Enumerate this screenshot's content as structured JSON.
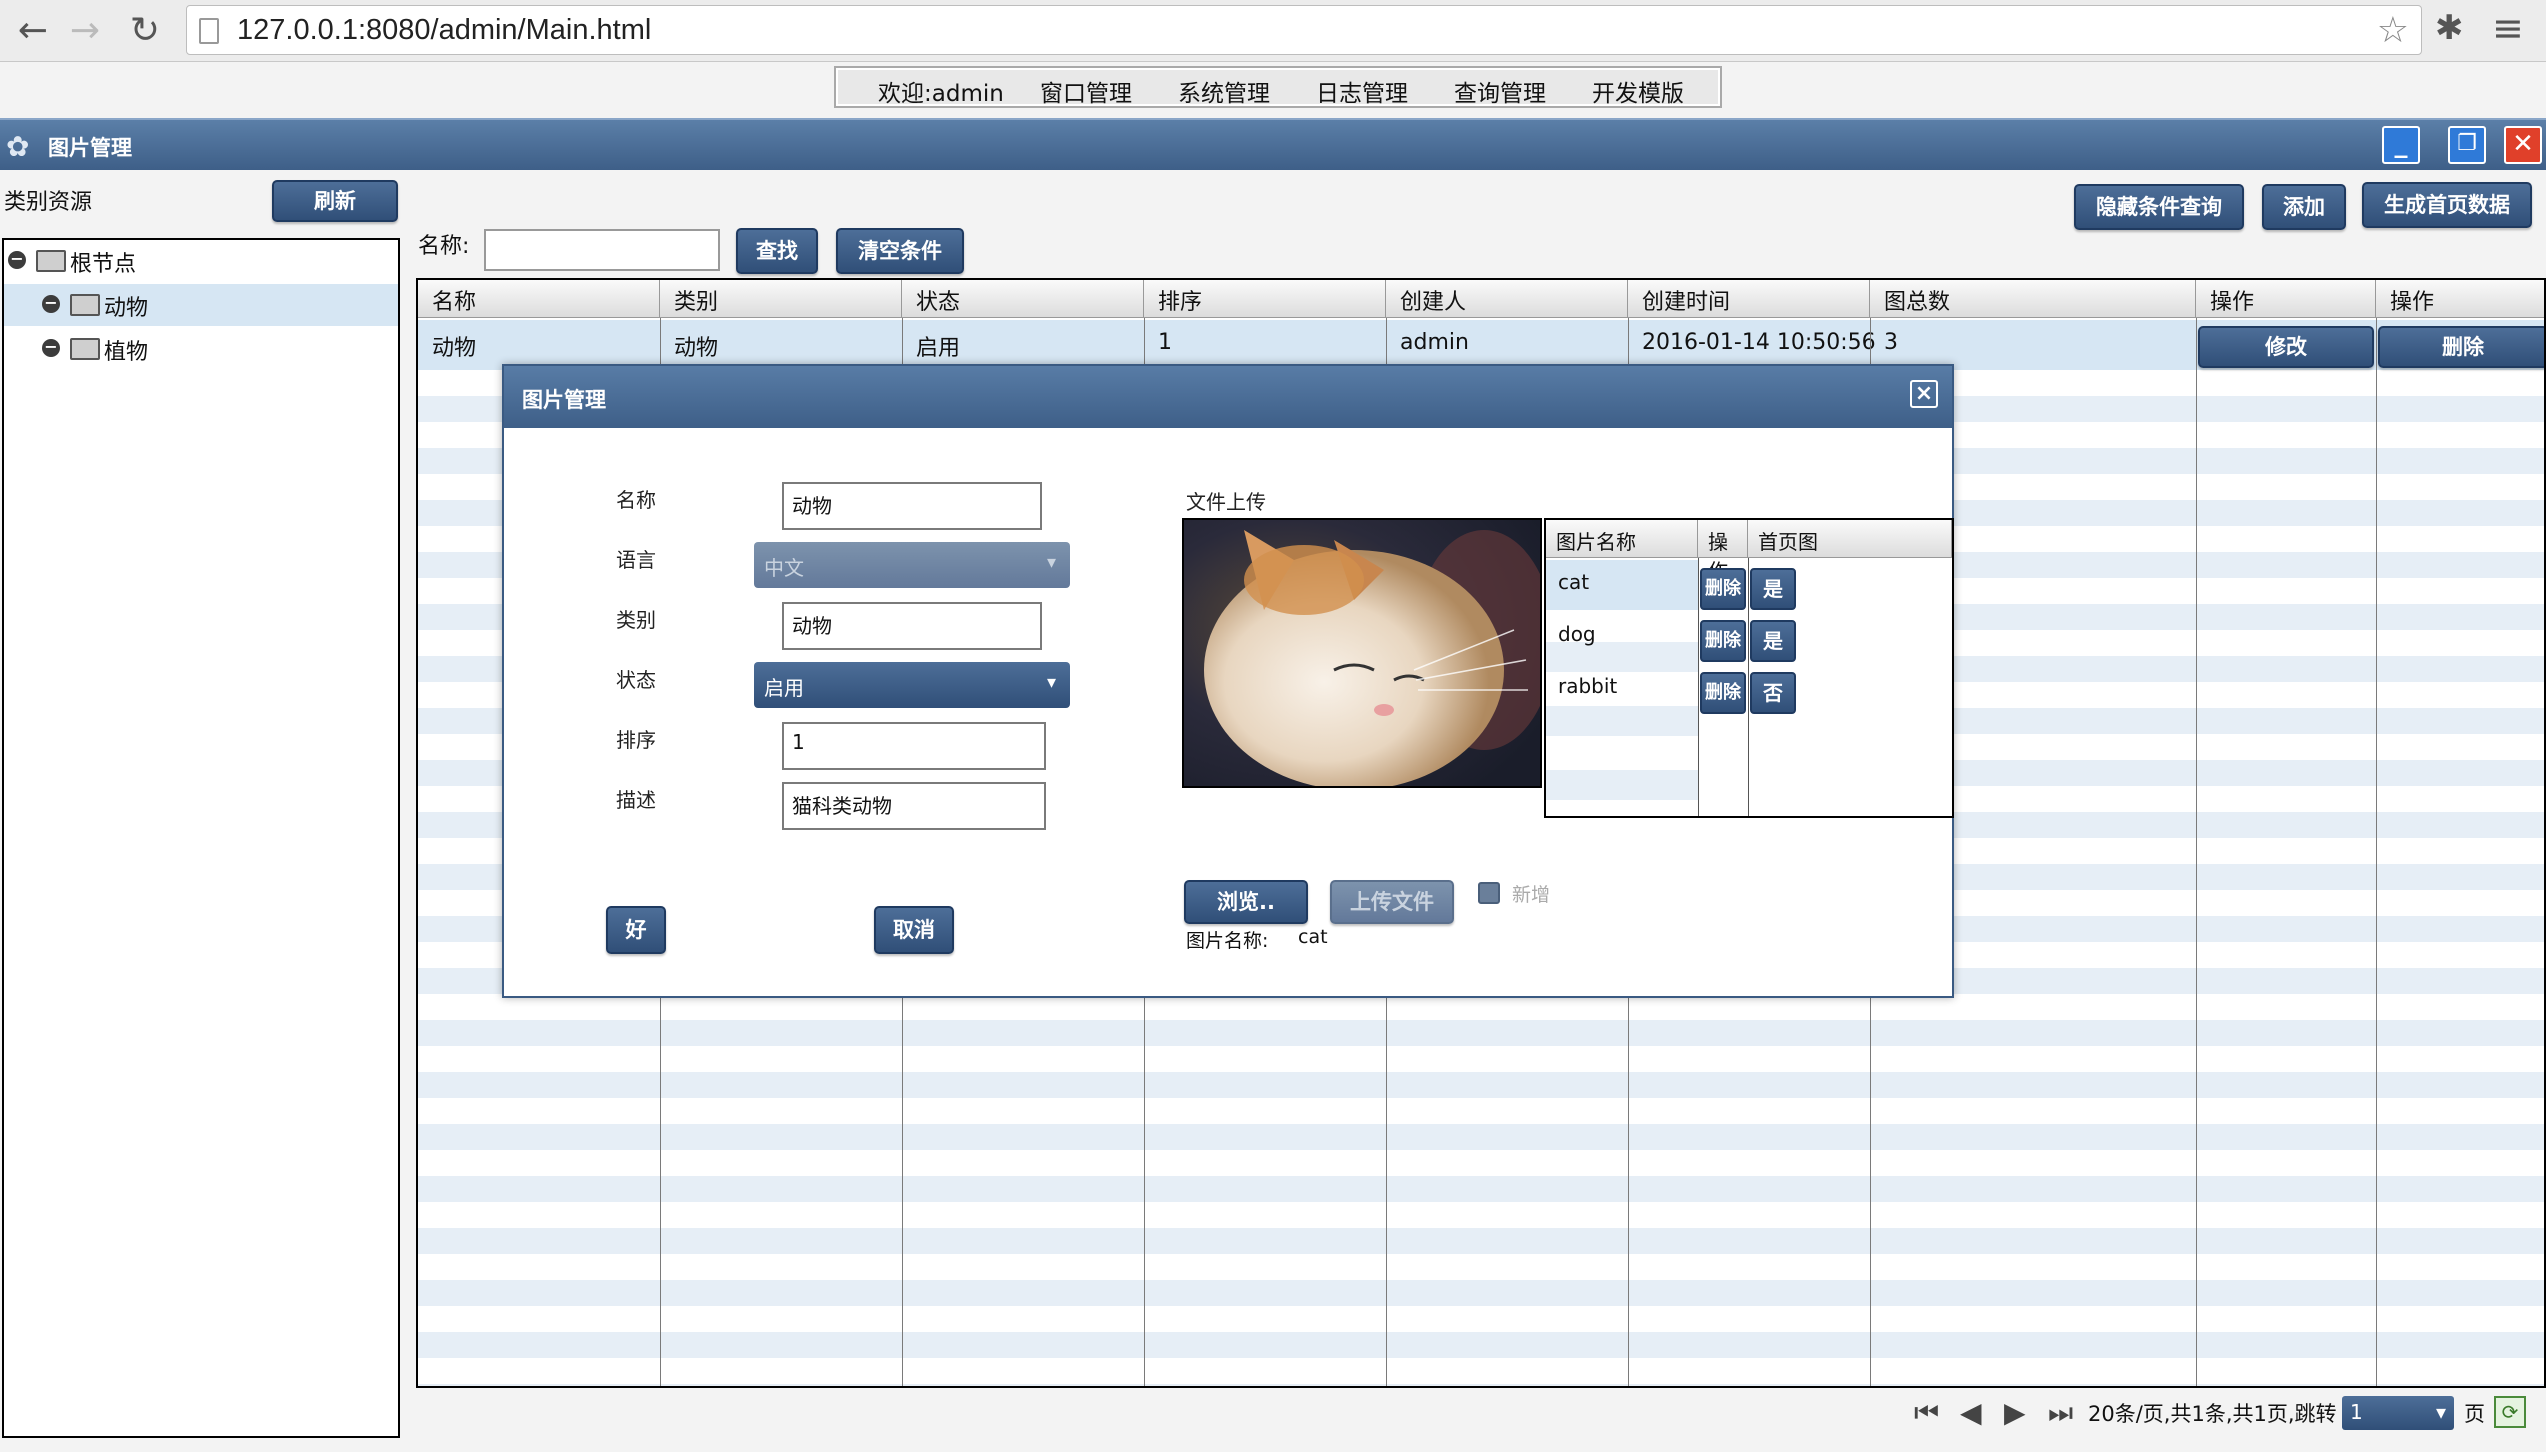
{
  "browser": {
    "url": "127.0.0.1:8080/admin/Main.html",
    "back_glyph": "←",
    "forward_glyph": "→",
    "reload_glyph": "↻"
  },
  "top_menu": {
    "welcome": "欢迎:admin",
    "items": [
      "窗口管理",
      "系统管理",
      "日志管理",
      "查询管理",
      "开发模版"
    ]
  },
  "window": {
    "title": "图片管理"
  },
  "left_panel": {
    "label": "类别资源",
    "refresh_button": "刷新",
    "tree": {
      "root": "根节点",
      "children": [
        "动物",
        "植物"
      ],
      "selected": "动物"
    }
  },
  "search": {
    "name_label": "名称:",
    "name_value": "",
    "search_button": "查找",
    "clear_button": "清空条件"
  },
  "toolbar": {
    "hide_query_button": "隐藏条件查询",
    "add_button": "添加",
    "generate_button": "生成首页数据"
  },
  "grid": {
    "columns": [
      "名称",
      "类别",
      "状态",
      "排序",
      "创建人",
      "创建时间",
      "图总数",
      "操作",
      "操作"
    ],
    "rows": [
      {
        "name": "动物",
        "category": "动物",
        "status": "启用",
        "order": "1",
        "creator": "admin",
        "created": "2016-01-14 10:50:56",
        "count": "3",
        "edit": "修改",
        "delete": "删除"
      }
    ]
  },
  "pager": {
    "summary": "20条/页,共1条,共1页,跳转",
    "page_value": "1",
    "page_suffix": "页"
  },
  "dialog": {
    "title": "图片管理",
    "close_glyph": "×",
    "form": {
      "name_label": "名称",
      "name_value": "动物",
      "language_label": "语言",
      "language_value": "中文",
      "category_label": "类别",
      "category_value": "动物",
      "status_label": "状态",
      "status_value": "启用",
      "order_label": "排序",
      "order_value": "1",
      "description_label": "描述",
      "description_value": "猫科类动物",
      "ok_button": "好",
      "cancel_button": "取消"
    },
    "upload": {
      "label": "文件上传",
      "browse_button": "浏览..",
      "upload_button": "上传文件",
      "new_label": "新增",
      "image_name_label": "图片名称:",
      "image_name_value": "cat",
      "columns": [
        "图片名称",
        "操作",
        "首页图"
      ],
      "images": [
        {
          "name": "cat",
          "action": "删除",
          "home": "是"
        },
        {
          "name": "dog",
          "action": "删除",
          "home": "是"
        },
        {
          "name": "rabbit",
          "action": "删除",
          "home": "否"
        }
      ]
    }
  },
  "colors": {
    "title_bar": "#3e5f88",
    "button": "#304f78",
    "selection": "#d6e6f3",
    "stripe": "#e6eef6",
    "close_button": "#e0402a"
  }
}
